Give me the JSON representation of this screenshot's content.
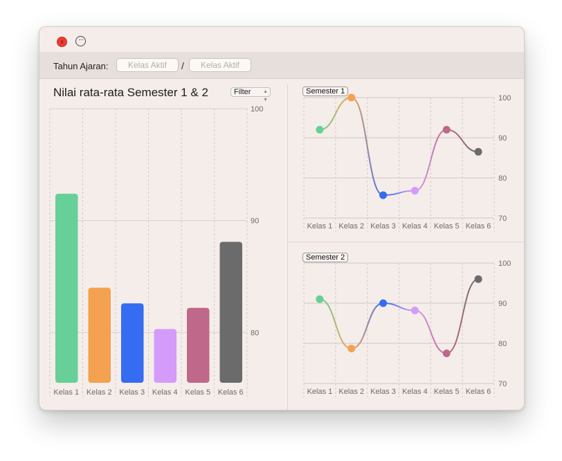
{
  "window": {
    "controls": {
      "close_icon": "close-icon",
      "more_icon": "ellipsis-circle-icon"
    }
  },
  "toolbar": {
    "label": "Tahun Ajaran:",
    "field1_placeholder": "Kelas Aktif",
    "separator": "/",
    "field2_placeholder": "Kelas Aktif"
  },
  "main_chart": {
    "title": "Nilai rata-rata Semester 1 & 2",
    "filter_label": "Filter"
  },
  "chart_data": [
    {
      "type": "bar",
      "title": "Nilai rata-rata Semester 1 & 2",
      "categories": [
        "Kelas 1",
        "Kelas 2",
        "Kelas 3",
        "Kelas 4",
        "Kelas 5",
        "Kelas 6"
      ],
      "values": [
        92.4,
        84,
        82.6,
        80.3,
        82.2,
        88.1
      ],
      "colors": [
        "#67cf98",
        "#f4a152",
        "#356cf1",
        "#d49bfb",
        "#c0688a",
        "#6b6b6b"
      ],
      "ylim": [
        75.5,
        100
      ],
      "yticks": [
        80,
        90,
        100
      ],
      "grid": true
    },
    {
      "type": "line",
      "title": "Semester 1",
      "categories": [
        "Kelas 1",
        "Kelas 2",
        "Kelas 3",
        "Kelas 4",
        "Kelas 5",
        "Kelas 6"
      ],
      "values": [
        92,
        100,
        75.7,
        76.8,
        92,
        86.5
      ],
      "colors": [
        "#67cf98",
        "#f4a152",
        "#356cf1",
        "#d49bfb",
        "#c0688a",
        "#6b6b6b"
      ],
      "ylim": [
        70,
        100
      ],
      "yticks": [
        70,
        80,
        90,
        100
      ],
      "grid": true
    },
    {
      "type": "line",
      "title": "Semester 2",
      "categories": [
        "Kelas 1",
        "Kelas 2",
        "Kelas 3",
        "Kelas 4",
        "Kelas 5",
        "Kelas 6"
      ],
      "values": [
        91,
        78.7,
        90,
        88.2,
        77.5,
        96
      ],
      "colors": [
        "#67cf98",
        "#f4a152",
        "#356cf1",
        "#d49bfb",
        "#c0688a",
        "#6b6b6b"
      ],
      "ylim": [
        70,
        100
      ],
      "yticks": [
        70,
        80,
        90,
        100
      ],
      "grid": true
    }
  ]
}
